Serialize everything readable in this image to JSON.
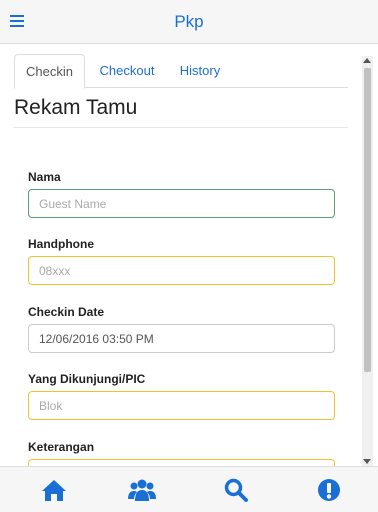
{
  "app": {
    "title": "Pkp"
  },
  "header": {
    "menu_icon": "hamburger-menu-icon"
  },
  "tabs": [
    {
      "label": "Checkin",
      "active": true
    },
    {
      "label": "Checkout",
      "active": false
    },
    {
      "label": "History",
      "active": false
    }
  ],
  "page": {
    "title": "Rekam Tamu"
  },
  "form": {
    "nama": {
      "label": "Nama",
      "placeholder": "Guest Name",
      "value": ""
    },
    "handphone": {
      "label": "Handphone",
      "placeholder": "08xxx",
      "value": ""
    },
    "checkin_date": {
      "label": "Checkin Date",
      "value": "12/06/2016 03:50 PM"
    },
    "pic": {
      "label": "Yang Dikunjungi/PIC",
      "placeholder": "Blok",
      "value": ""
    },
    "keterangan": {
      "label": "Keterangan",
      "value": ""
    }
  },
  "bottom_nav": [
    {
      "icon": "home-icon"
    },
    {
      "icon": "users-icon"
    },
    {
      "icon": "search-icon"
    },
    {
      "icon": "alert-icon"
    }
  ],
  "colors": {
    "accent": "#1a6fd6",
    "field_focus": "#5a9e6e",
    "field_warning": "#f0c230"
  }
}
